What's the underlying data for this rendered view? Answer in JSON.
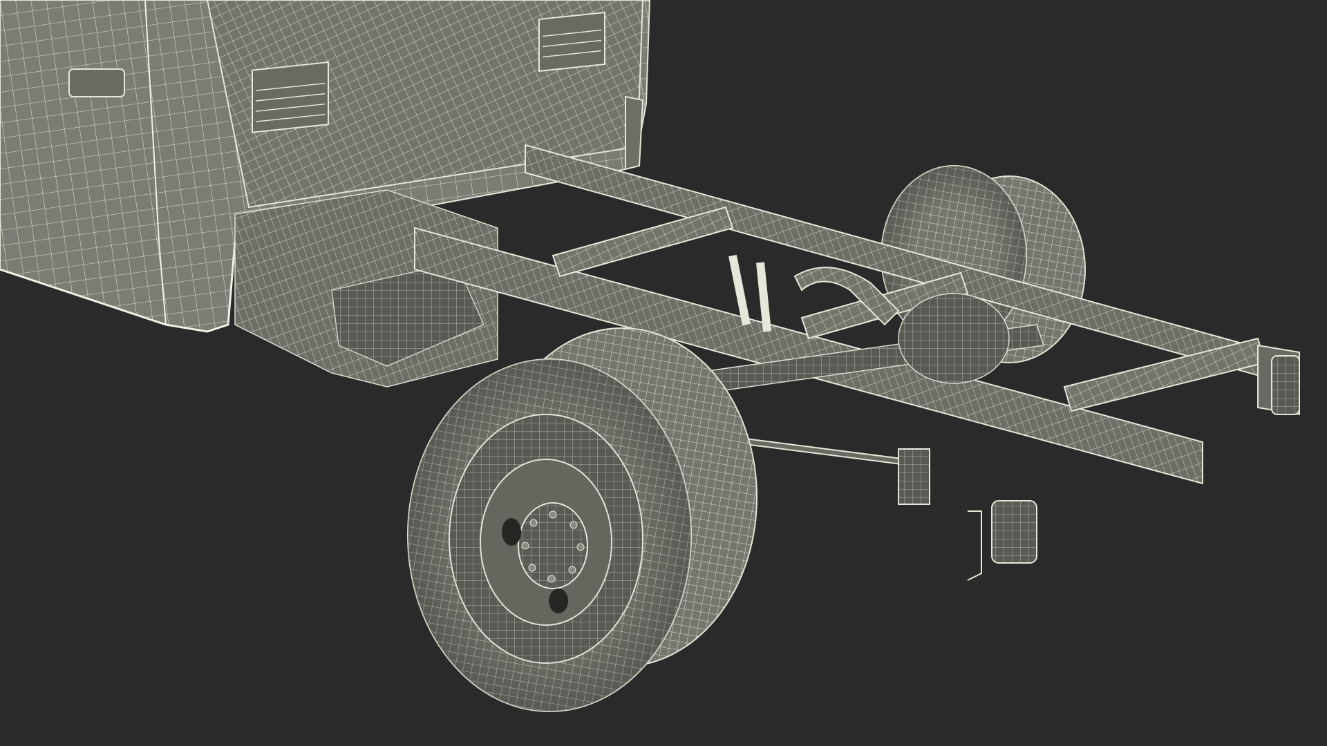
{
  "scene": {
    "subject": "truck-chassis-wireframe-render",
    "colors": {
      "background": "#2a2a2a",
      "surface": "#7a7a72",
      "surface_dark": "#5f5f58",
      "surface_light": "#8e8e86",
      "wire": "#dcdcd0",
      "shadow": "#3a3a36"
    }
  }
}
